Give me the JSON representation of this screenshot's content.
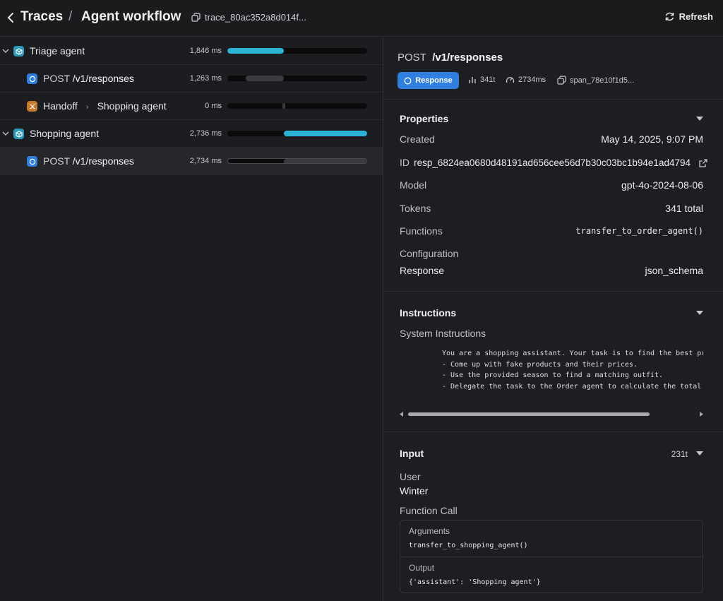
{
  "header": {
    "traces_label": "Traces",
    "separator": "/",
    "title": "Agent workflow",
    "trace_id": "trace_80ac352a8d014f...",
    "refresh_label": "Refresh"
  },
  "spans": [
    {
      "label": "Triage agent",
      "duration": "1,846 ms",
      "progress": {
        "start": 0,
        "end": 0.405
      }
    },
    {
      "method": "POST",
      "path": "/v1/responses",
      "duration": "1,263 ms",
      "progress": {
        "start": 0.13,
        "end": 0.405
      }
    },
    {
      "label": "Handoff",
      "target": "Shopping agent",
      "duration": "0 ms",
      "progress": {
        "start": 0.395,
        "end": 0.415
      }
    },
    {
      "label": "Shopping agent",
      "duration": "2,736 ms",
      "progress": {
        "start": 0.405,
        "end": 1.0
      }
    },
    {
      "method": "POST",
      "path": "/v1/responses",
      "duration": "2,734 ms",
      "progress": {
        "start": 0.405,
        "end": 1.0
      }
    }
  ],
  "detail": {
    "method": "POST",
    "path": "/v1/responses",
    "badge": "Response",
    "tokens_stat": "341t",
    "time_stat": "2734ms",
    "span_id": "span_78e10f1d5...",
    "properties": {
      "title": "Properties",
      "created_label": "Created",
      "created_value": "May 14, 2025, 9:07 PM",
      "id_label": "ID",
      "id_value": "resp_6824ea0680d48191ad656cee56d7b30c03bc1b94e1ad4794",
      "model_label": "Model",
      "model_value": "gpt-4o-2024-08-06",
      "tokens_label": "Tokens",
      "tokens_value": "341 total",
      "functions_label": "Functions",
      "functions_value": "transfer_to_order_agent()",
      "configuration_label": "Configuration",
      "response_label": "Response",
      "response_value": "json_schema"
    },
    "instructions": {
      "title": "Instructions",
      "system_label": "System Instructions",
      "lines": [
        "You are a shopping assistant. Your task is to find the best price",
        "- Come up with fake products and their prices.",
        "- Use the provided season to find a matching outfit.",
        "- Delegate the task to the Order agent to calculate the total pric"
      ]
    },
    "input": {
      "title": "Input",
      "tokens": "231t",
      "user_label": "User",
      "user_value": "Winter",
      "function_call_label": "Function Call",
      "arguments_label": "Arguments",
      "arguments_value": "transfer_to_shopping_agent()",
      "output_label": "Output",
      "output_value": "{'assistant': 'Shopping agent'}"
    }
  },
  "colors": {
    "accent_cyan": "#2bb3d6",
    "accent_blue": "#2f7fe0",
    "handoff_orange": "#c77a2a",
    "bar_gray": "#3a3b3f"
  }
}
